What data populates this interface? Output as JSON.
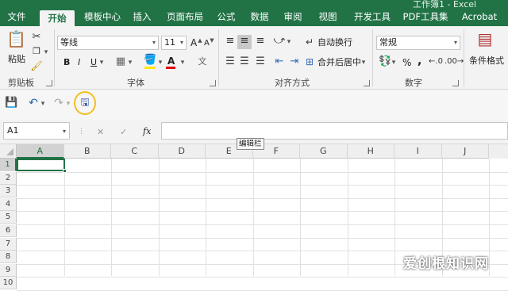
{
  "window": {
    "title": "工作簿1 - Excel"
  },
  "tabs": [
    {
      "label": "文件"
    },
    {
      "label": "开始"
    },
    {
      "label": "模板中心"
    },
    {
      "label": "插入"
    },
    {
      "label": "页面布局"
    },
    {
      "label": "公式"
    },
    {
      "label": "数据"
    },
    {
      "label": "审阅"
    },
    {
      "label": "视图"
    },
    {
      "label": "开发工具"
    },
    {
      "label": "PDF工具集"
    },
    {
      "label": "Acrobat"
    }
  ],
  "ribbon": {
    "clipboard": {
      "label": "剪贴板",
      "paste_label": "粘贴"
    },
    "font": {
      "label": "字体",
      "font_name": "等线",
      "font_size": "11",
      "grow_label": "A",
      "shrink_label": "A",
      "bold_label": "B",
      "italic_label": "I",
      "underline_label": "U",
      "font_color_label": "A"
    },
    "alignment": {
      "label": "对齐方式",
      "wrap_text_label": "自动换行",
      "merge_center_label": "合并后居中"
    },
    "number": {
      "label": "数字",
      "format": "常规",
      "percent_label": "%",
      "comma_label": ","
    },
    "styles": {
      "conditional_label": "条件格式"
    }
  },
  "formula_bar": {
    "name_box": "A1",
    "cancel_label": "✕",
    "enter_label": "✓",
    "fx_label": "fx",
    "value": ""
  },
  "tooltip": {
    "text": "编辑栏"
  },
  "sheet": {
    "columns": [
      "A",
      "B",
      "C",
      "D",
      "E",
      "F",
      "G",
      "H",
      "I",
      "J"
    ],
    "rows": [
      "1",
      "2",
      "3",
      "4",
      "5",
      "6",
      "7",
      "8",
      "9",
      "10"
    ],
    "selected_cell": "A1"
  },
  "watermark": {
    "text": "爱创根知识网"
  },
  "colors": {
    "accent": "#217346",
    "highlight_ring": "#f0c020"
  }
}
